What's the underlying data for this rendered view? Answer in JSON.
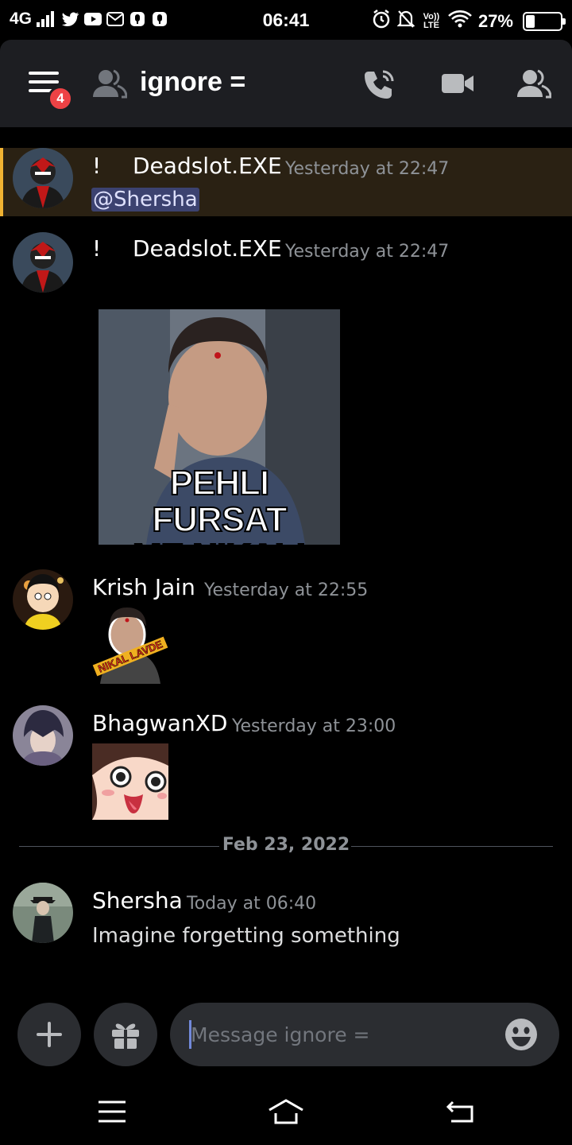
{
  "status_bar": {
    "network": "4G",
    "time": "06:41",
    "volte": "Vo)) LTE",
    "battery": "27%",
    "battery_level": 0.27,
    "app_icons": [
      "twitter-icon",
      "youtube-icon",
      "gmail-icon",
      "voicemail-icon",
      "voicemail-icon"
    ]
  },
  "header": {
    "channel_name": "ignore =",
    "unread_badge": "4",
    "icons": [
      "menu-icon",
      "dm-user-icon",
      "voice-call-icon",
      "video-call-icon",
      "member-list-icon"
    ]
  },
  "messages": [
    {
      "prefix": "!",
      "author": "Deadslot.EXE",
      "timestamp": "Yesterday at 22:47",
      "mention": "@Shersha",
      "highlighted": true
    },
    {
      "prefix": "!",
      "author": "Deadslot.EXE",
      "timestamp": "Yesterday at 22:47",
      "image_caption_line1": "PEHLI FURSAT",
      "image_caption_line2": "ME NIKAL!"
    },
    {
      "author": "Krish Jain",
      "timestamp": "Yesterday at 22:55",
      "sticker_text": "NIKAL LAVDE"
    },
    {
      "author": "BhagwanXD",
      "timestamp": "Yesterday at 23:00"
    },
    {
      "author": "Shersha",
      "timestamp": "Today at 06:40",
      "text": "Imagine forgetting something"
    }
  ],
  "date_divider": "Feb 23, 2022",
  "composer": {
    "placeholder": "Message ignore =",
    "value": ""
  },
  "colors": {
    "background": "#000000",
    "header": "#1d1e22",
    "mention_bg": "#3c4270",
    "highlight_bar": "#f0b232",
    "badge": "#ed4245"
  }
}
